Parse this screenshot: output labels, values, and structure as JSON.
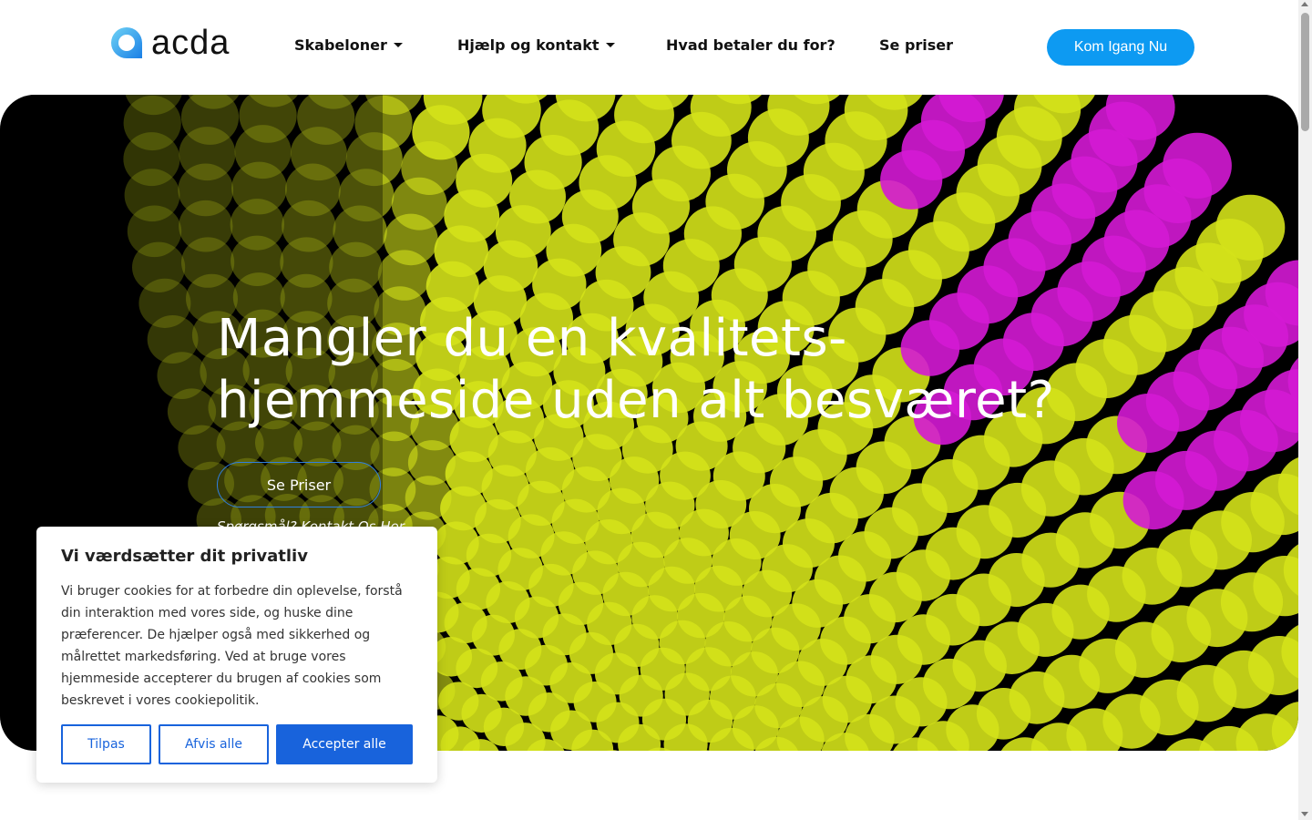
{
  "header": {
    "logo_text": "acda",
    "nav": [
      {
        "label": "Skabeloner",
        "dropdown": true
      },
      {
        "label": "Hjælp og kontakt",
        "dropdown": true
      },
      {
        "label": "Hvad betaler du for?",
        "dropdown": false
      },
      {
        "label": "Se priser",
        "dropdown": false
      }
    ],
    "cta_label": "Kom Igang Nu"
  },
  "hero": {
    "title_line1": "Mangler du en kvalitets-",
    "title_line2": "hjemmeside uden alt besværet?",
    "button_label": "Se Priser",
    "contact_link": "Spørgsmål? Kontakt Os Her"
  },
  "cookie_banner": {
    "title": "Vi værdsætter dit privatliv",
    "text": "Vi bruger cookies for at forbedre din oplevelse, forstå din interaktion med vores side, og huske dine præferencer. De hjælper også med sikkerhed og målrettet markedsføring. Ved at bruge vores hjemmeside accepterer du brugen af cookies som beskrevet i vores cookiepolitik.",
    "btn_customize": "Tilpas",
    "btn_reject": "Afvis alle",
    "btn_accept": "Accepter alle"
  },
  "colors": {
    "accent": "#0d9af2",
    "cookie_blue": "#1863dc",
    "dot_yellow": "#d4e21a",
    "dot_magenta": "#d41ad4"
  },
  "icons": [
    "acda-logo-icon",
    "caret-down-icon",
    "scroll-up-icon",
    "scroll-down-icon"
  ]
}
